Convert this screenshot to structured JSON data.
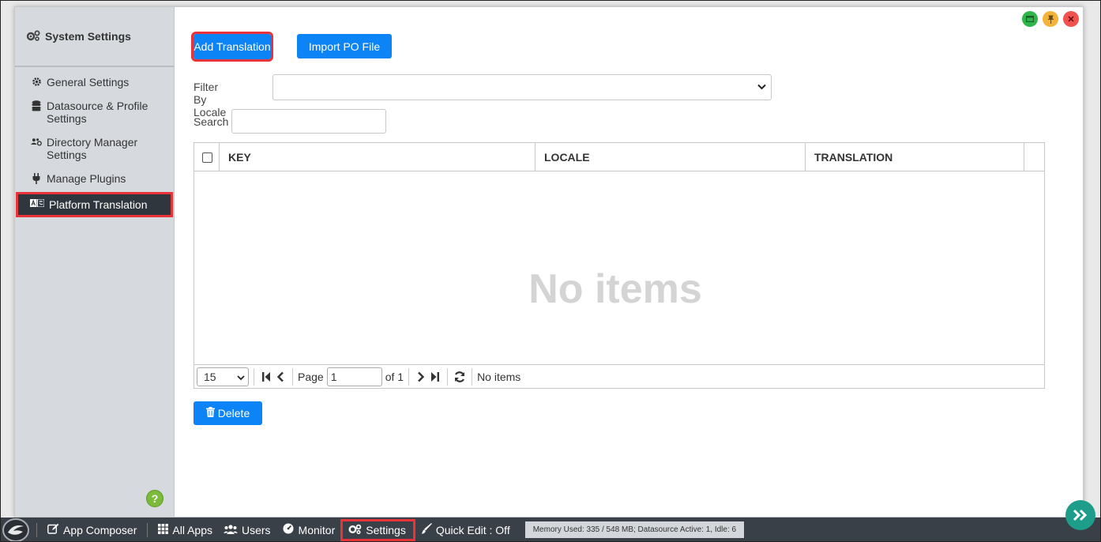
{
  "sidebar": {
    "title": "System Settings",
    "items": [
      {
        "label": "General Settings",
        "icon": "gear-icon"
      },
      {
        "label": "Datasource & Profile Settings",
        "icon": "database-icon"
      },
      {
        "label": "Directory Manager Settings",
        "icon": "users-cog-icon"
      },
      {
        "label": "Manage Plugins",
        "icon": "plug-icon"
      },
      {
        "label": "Platform Translation",
        "icon": "language-icon",
        "active": true
      }
    ]
  },
  "toolbar": {
    "add_label": "Add Translation",
    "import_label": "Import PO File"
  },
  "filter": {
    "label": "Filter By Locale",
    "value": ""
  },
  "search": {
    "label": "Search",
    "value": ""
  },
  "table": {
    "columns": [
      "KEY",
      "LOCALE",
      "TRANSLATION"
    ],
    "empty_text": "No items"
  },
  "pager": {
    "page_size": "15",
    "page_label": "Page",
    "page_value": "1",
    "of_label": "of 1",
    "status": "No items"
  },
  "actions": {
    "delete_label": "Delete"
  },
  "taskbar": {
    "items": [
      "App Composer",
      "All Apps",
      "Users",
      "Monitor",
      "Settings",
      "Quick Edit : Off"
    ],
    "memory": "Memory Used: 335 / 548 MB; Datasource Active: 1, Idle: 6"
  },
  "colors": {
    "primary": "#0d84f5",
    "highlight": "#e8333a",
    "sidebar_bg": "#d6dadf",
    "active_bg": "#2f363d",
    "taskbar_bg": "#3a4047"
  }
}
